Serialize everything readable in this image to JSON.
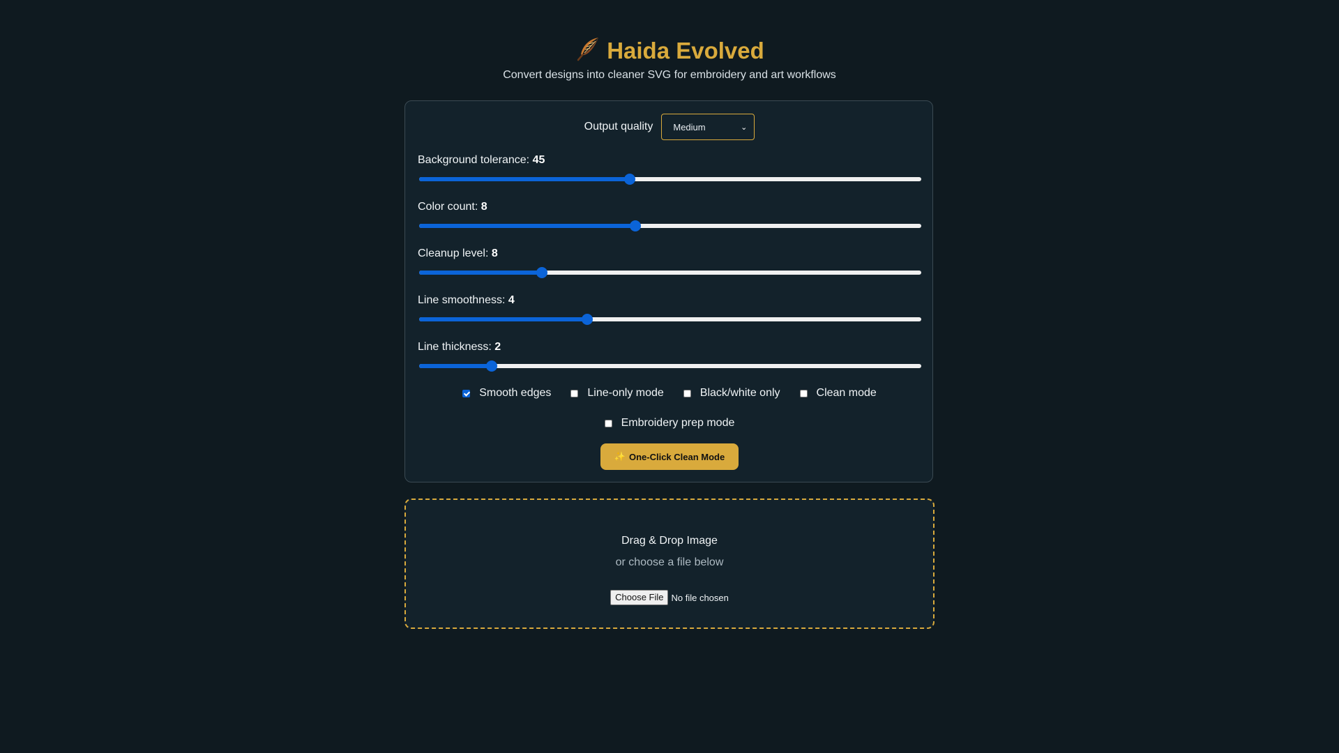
{
  "header": {
    "icon": "feather-icon",
    "title": "Haida Evolved",
    "subtitle": "Convert designs into cleaner SVG for embroidery and art workflows"
  },
  "settings": {
    "quality_label": "Output quality",
    "quality_value": "Medium",
    "sliders": [
      {
        "label": "Background tolerance:",
        "value": "45",
        "fraction": 0.42
      },
      {
        "label": "Color count:",
        "value": "8",
        "fraction": 0.43
      },
      {
        "label": "Cleanup level:",
        "value": "8",
        "fraction": 0.245
      },
      {
        "label": "Line smoothness:",
        "value": "4",
        "fraction": 0.335
      },
      {
        "label": "Line thickness:",
        "value": "2",
        "fraction": 0.145
      }
    ],
    "checkboxes": [
      {
        "label": "Smooth edges",
        "checked": true
      },
      {
        "label": "Line-only mode",
        "checked": false
      },
      {
        "label": "Black/white only",
        "checked": false
      },
      {
        "label": "Clean mode",
        "checked": false
      },
      {
        "label": "Embroidery prep mode",
        "checked": false
      }
    ],
    "clean_button_icon": "sparkles-icon",
    "clean_button_label": "One-Click Clean Mode"
  },
  "dropzone": {
    "title": "Drag & Drop Image",
    "subtitle": "or choose a file below",
    "file_button": "Choose File",
    "file_status": "No file chosen"
  },
  "colors": {
    "background": "#0f1a20",
    "panel": "#13222b",
    "accent": "#d9aa3c",
    "slider": "#0b64d8"
  }
}
